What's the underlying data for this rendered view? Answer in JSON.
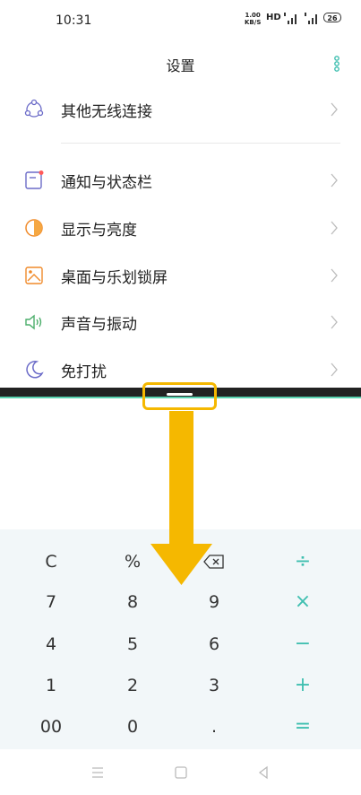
{
  "status": {
    "time": "10:31",
    "speed_value": "1.00",
    "speed_unit": "KB/S",
    "hd": "HD",
    "battery": "26"
  },
  "header": {
    "title": "设置",
    "more_icon": "more-vertical-icon"
  },
  "settings": [
    {
      "label": "其他无线连接",
      "icon": "wireless-connection-icon"
    },
    {
      "label": "通知与状态栏",
      "icon": "notification-icon"
    },
    {
      "label": "显示与亮度",
      "icon": "display-brightness-icon"
    },
    {
      "label": "桌面与乐划锁屏",
      "icon": "wallpaper-icon"
    },
    {
      "label": "声音与振动",
      "icon": "sound-icon"
    },
    {
      "label": "免打扰",
      "icon": "moon-icon"
    }
  ],
  "calculator": {
    "row1": [
      "C",
      "%",
      "⌫",
      "÷"
    ],
    "row2": [
      "7",
      "8",
      "9",
      "×"
    ],
    "row3": [
      "4",
      "5",
      "6",
      "−"
    ],
    "row4": [
      "1",
      "2",
      "3",
      "+"
    ],
    "row5": [
      "00",
      "0",
      ".",
      "="
    ]
  },
  "colors": {
    "accent": "#3fbfb0",
    "highlight": "#f5b800",
    "split_line": "#5ad3b0"
  }
}
